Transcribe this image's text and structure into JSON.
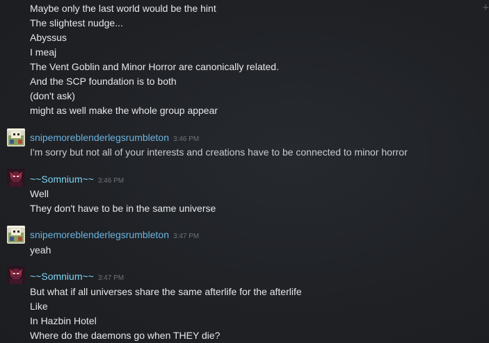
{
  "chat": {
    "top_lines": [
      "Maybe only the last world would be the hint",
      "The slightest nudge...",
      "Abyssus",
      "I meaj",
      "The Vent Goblin and Minor Horror are canonically related.",
      "And the SCP foundation is to both",
      "(don't ask)",
      "might as well make the whole group appear"
    ],
    "groups": [
      {
        "author": "snipemoreblenderlegsrumbleton",
        "time": "3:46 PM",
        "lines": [
          "I'm sorry but not all of your interests and creations have to be connected to minor horror"
        ]
      },
      {
        "author": "~~Somnium~~",
        "time": "3:46 PM",
        "lines": [
          "Well",
          "They don't have to be in the same universe"
        ]
      },
      {
        "author": "snipemoreblenderlegsrumbleton",
        "time": "3:47 PM",
        "lines": [
          "yeah"
        ]
      },
      {
        "author": "~~Somnium~~",
        "time": "3:47 PM",
        "lines": [
          "But what if all universes share the same afterlife for the afterlife",
          "Like",
          "In Hazbin Hotel",
          "Where do the daemons go when THEY die?"
        ]
      }
    ]
  },
  "colors": {
    "background": "#1e2024",
    "text": "#e8e8e8",
    "snipe_name": "#6cb4e0",
    "somnium_name": "#7fd4f5",
    "timestamp": "#6e7378"
  },
  "icons": {
    "corner": "plus-icon",
    "avatar_snipe": "pixel-art-avatar",
    "avatar_somnium": "dark-character-avatar"
  }
}
